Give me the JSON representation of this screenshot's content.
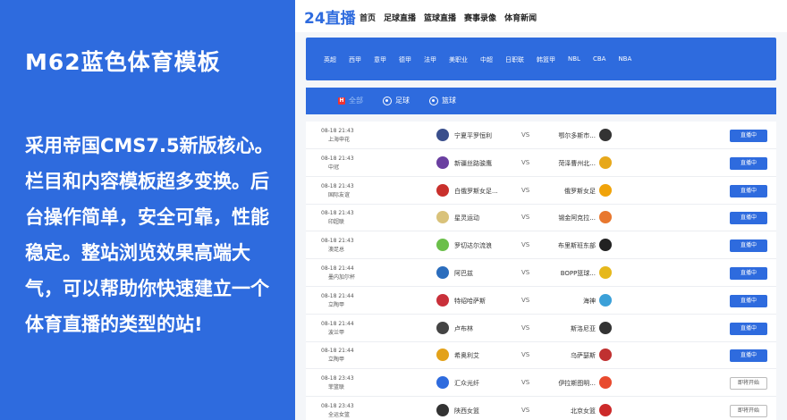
{
  "promo": {
    "title": "M62蓝色体育模板",
    "description": "采用帝国CMS7.5新版核心。栏目和内容模板超多变换。后台操作简单，安全可靠，性能稳定。整站浏览效果高端大气，可以帮助你快速建立一个体育直播的类型的站!"
  },
  "header": {
    "logo": "24直播",
    "nav": [
      "首页",
      "足球直播",
      "篮球直播",
      "赛事录像",
      "体育新闻"
    ]
  },
  "leagues": [
    "英超",
    "西甲",
    "意甲",
    "德甲",
    "法甲",
    "美职业",
    "中超",
    "日职联",
    "韩篮甲",
    "NBL",
    "CBA",
    "NBA"
  ],
  "tabs": [
    {
      "label": "全部",
      "icon": "h-icon"
    },
    {
      "label": "足球",
      "icon": "football-icon"
    },
    {
      "label": "篮球",
      "icon": "basketball-icon"
    }
  ],
  "matches": [
    {
      "time": "08-18 21:43",
      "league": "上海申花",
      "team_a": "宁夏平罗恒利",
      "team_b": "鄂尔多斯市...",
      "action": "直播中",
      "status": "live",
      "color_a": "#3a4f8c",
      "color_b": "#333333"
    },
    {
      "time": "08-18 21:43",
      "league": "中冠",
      "team_a": "新疆丝路骏鹰",
      "team_b": "菏泽曹州北...",
      "action": "直播中",
      "status": "live",
      "color_a": "#6a3fa0",
      "color_b": "#e7a81b"
    },
    {
      "time": "08-18 21:43",
      "league": "国际友谊",
      "team_a": "白俄罗斯女足...",
      "team_b": "俄罗斯女足",
      "action": "直播中",
      "status": "live",
      "color_a": "#c9302c",
      "color_b": "#f0a30a"
    },
    {
      "time": "08-18 21:43",
      "league": "印超联",
      "team_a": "星灵运动",
      "team_b": "锡金阿克拉...",
      "action": "直播中",
      "status": "live",
      "color_a": "#d9c27a",
      "color_b": "#e8772e"
    },
    {
      "time": "08-18 21:43",
      "league": "澳足总",
      "team_a": "罗切达尔流浪",
      "team_b": "布里斯班东部",
      "action": "直播中",
      "status": "live",
      "color_a": "#6bbf4a",
      "color_b": "#222222"
    },
    {
      "time": "08-18 21:44",
      "league": "墨内加尔杯",
      "team_a": "阿巴兹",
      "team_b": "BOPP篮球...",
      "action": "直播中",
      "status": "live",
      "color_a": "#2b6dbd",
      "color_b": "#e6b81c"
    },
    {
      "time": "08-18 21:44",
      "league": "立陶甲",
      "team_a": "特绍哈萨斯",
      "team_b": "海神",
      "action": "直播中",
      "status": "live",
      "color_a": "#c9303a",
      "color_b": "#3ba0d8"
    },
    {
      "time": "08-18 21:44",
      "league": "波兰甲",
      "team_a": "卢布林",
      "team_b": "斯洛尼亚",
      "action": "直播中",
      "status": "live",
      "color_a": "#444444",
      "color_b": "#333333"
    },
    {
      "time": "08-18 21:44",
      "league": "立陶甲",
      "team_a": "希奥利艾",
      "team_b": "乌萨瑟斯",
      "action": "直播中",
      "status": "live",
      "color_a": "#e3a21a",
      "color_b": "#c03030"
    },
    {
      "time": "08-18 23:43",
      "league": "菲篮联",
      "team_a": "汇众光纤",
      "team_b": "伊拉斯图明...",
      "action": "即将开始",
      "status": "soon",
      "color_a": "#2e6bde",
      "color_b": "#e84a2e"
    },
    {
      "time": "08-18 23:43",
      "league": "全运女篮",
      "team_a": "陕西女篮",
      "team_b": "北京女篮",
      "action": "即将开始",
      "status": "soon",
      "color_a": "#333333",
      "color_b": "#cc2a2a"
    }
  ]
}
